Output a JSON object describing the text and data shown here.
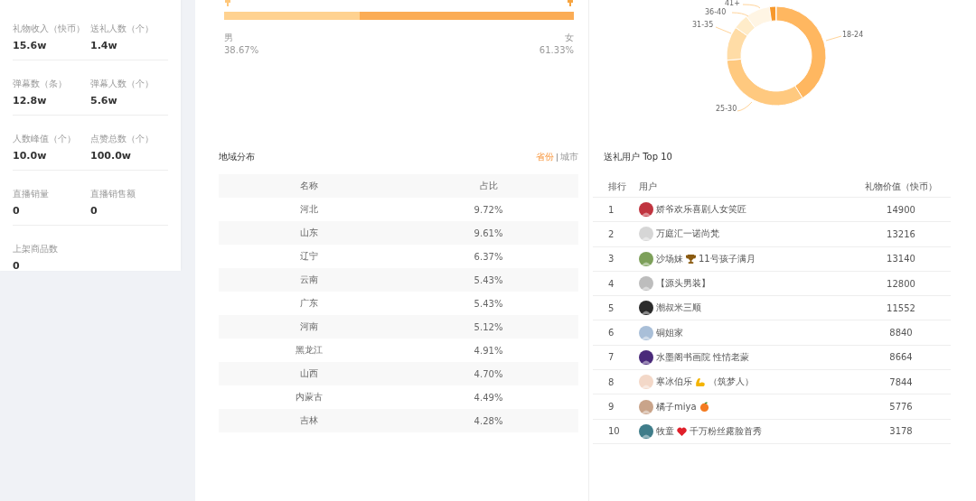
{
  "stat_rows": [
    [
      {
        "label": "礼物收入（快币）",
        "value": "15.6w"
      },
      {
        "label": "送礼人数（个）",
        "value": "1.4w"
      }
    ],
    [
      {
        "label": "弹幕数（条）",
        "value": "12.8w"
      },
      {
        "label": "弹幕人数（个）",
        "value": "5.6w"
      }
    ],
    [
      {
        "label": "人数峰值（个）",
        "value": "10.0w"
      },
      {
        "label": "点赞总数（个）",
        "value": "100.0w"
      }
    ],
    [
      {
        "label": "直播销量",
        "value": "0"
      },
      {
        "label": "直播销售额",
        "value": "0"
      }
    ],
    [
      {
        "label": "上架商品数",
        "value": "0"
      }
    ]
  ],
  "gender": {
    "level": 0.3867,
    "segments": [
      {
        "label": "男",
        "value": "38.67%"
      },
      {
        "label": "女",
        "value": "61.33%"
      }
    ]
  },
  "age": {
    "labels": [
      "18-24",
      "25-30",
      "31-35",
      "36-40",
      "41+"
    ]
  },
  "region": {
    "title": "地域分布",
    "toggle": [
      {
        "label": "省份",
        "selected": true
      },
      {
        "label": "城市",
        "selected": false
      }
    ],
    "columns": [
      "名称",
      "占比"
    ],
    "rows": [
      {
        "name": "河北",
        "share": "9.72%"
      },
      {
        "name": "山东",
        "share": "9.61%"
      },
      {
        "name": "辽宁",
        "share": "6.37%"
      },
      {
        "name": "云南",
        "share": "5.43%"
      },
      {
        "name": "广东",
        "share": "5.43%"
      },
      {
        "name": "河南",
        "share": "5.12%"
      },
      {
        "name": "黑龙江",
        "share": "4.91%"
      },
      {
        "name": "山西",
        "share": "4.70%"
      },
      {
        "name": "内蒙古",
        "share": "4.49%"
      },
      {
        "name": "吉林",
        "share": "4.28%"
      }
    ]
  },
  "top_users": {
    "title": "送礼用户 Top 10",
    "columns": [
      "排行",
      "用户",
      "礼物价值（快币）"
    ],
    "rows": [
      {
        "rank": "1",
        "name": "娇爷欢乐喜剧人女笑匠",
        "value": "14900"
      },
      {
        "rank": "2",
        "name": "万庭汇一诺尚梵",
        "value": "13216"
      },
      {
        "rank": "3",
        "name": "沙场妹",
        "kind": "trophy",
        "suffix": "11号孩子满月",
        "value": "13140"
      },
      {
        "rank": "4",
        "name": "【源头男装】",
        "value": "12800"
      },
      {
        "rank": "5",
        "name": "潮叔米三顺",
        "value": "11552"
      },
      {
        "rank": "6",
        "name": "铜姐家",
        "value": "8840"
      },
      {
        "rank": "7",
        "name": "水墨阁书画院 性情老蒙",
        "value": "8664"
      },
      {
        "rank": "8",
        "name": "寒冰伯乐",
        "kind": "arm",
        "suffix": "（筑梦人）",
        "value": "7844"
      },
      {
        "rank": "9",
        "name": "橘子miya",
        "kind": "fruit",
        "value": "5776"
      },
      {
        "rank": "10",
        "name": "牧童",
        "kind": "heart",
        "suffix": "千万粉丝露脸首秀",
        "value": "3178"
      }
    ]
  }
}
